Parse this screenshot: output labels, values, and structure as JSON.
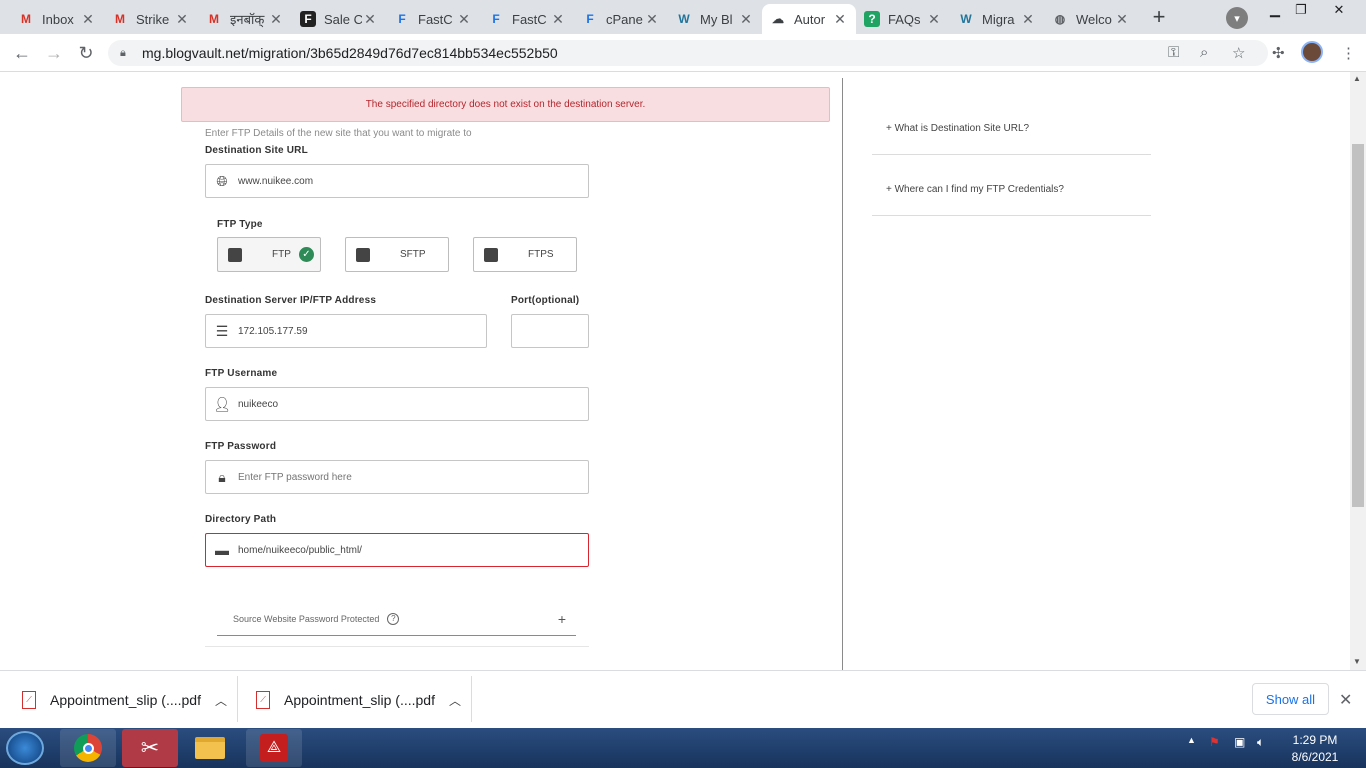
{
  "browser": {
    "tabs": [
      {
        "title": "Inbox",
        "icon": "gmail-icon"
      },
      {
        "title": "Strike",
        "icon": "gmail-icon"
      },
      {
        "title": "इनबॉक्",
        "icon": "gmail-icon"
      },
      {
        "title": "Sale C",
        "icon": "fastcomet-f-icon"
      },
      {
        "title": "FastC",
        "icon": "fastcomet-icon"
      },
      {
        "title": "FastC",
        "icon": "fastcomet-icon"
      },
      {
        "title": "cPane",
        "icon": "fastcomet-icon"
      },
      {
        "title": "My Bl",
        "icon": "wordpress-icon"
      },
      {
        "title": "Autor",
        "icon": "blogvault-icon"
      },
      {
        "title": "FAQs",
        "icon": "faq-icon"
      },
      {
        "title": "Migra",
        "icon": "wordpress-icon"
      },
      {
        "title": "Welco",
        "icon": "globe-icon"
      }
    ],
    "url": "mg.blogvault.net/migration/3b65d2849d76d7ec814bb534ec552b50"
  },
  "form": {
    "alert": "The specified directory does not exist on the destination server.",
    "hint": "Enter FTP Details of the new site that you want to migrate to",
    "dest_url_label": "Destination Site URL",
    "dest_url_value": "www.nuikee.com",
    "ftp_type_label": "FTP Type",
    "ftp_types": [
      "FTP",
      "SFTP",
      "FTPS"
    ],
    "server_label": "Destination Server IP/FTP Address",
    "server_value": "172.105.177.59",
    "port_label": "Port(optional)",
    "port_value": "",
    "username_label": "FTP Username",
    "username_value": "nuikeeco",
    "password_label": "FTP Password",
    "password_placeholder": "Enter FTP password here",
    "dir_label": "Directory Path",
    "dir_value": "home/nuikeeco/public_html/",
    "protected_label": "Source Website Password Protected",
    "protected_toggle": "+"
  },
  "sidebar": {
    "faqs": [
      "+ What is Destination Site URL?",
      "+ Where can I find my FTP Credentials?"
    ]
  },
  "downloads": {
    "items": [
      "Appointment_slip (....pdf",
      "Appointment_slip (....pdf"
    ],
    "show_all": "Show all"
  },
  "taskbar": {
    "time": "1:29 PM",
    "date": "8/6/2021"
  }
}
